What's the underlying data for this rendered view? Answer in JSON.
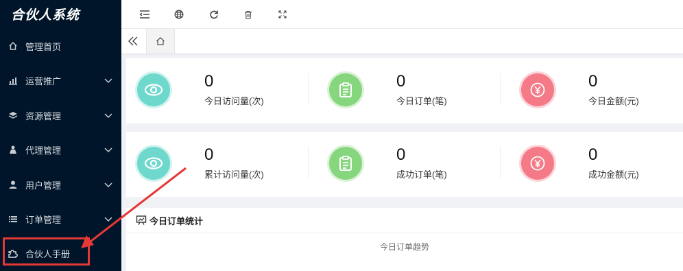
{
  "sidebar": {
    "logo": "合伙人系统",
    "items": [
      {
        "label": "管理首页",
        "icon": "home-icon"
      },
      {
        "label": "运营推广",
        "icon": "chart-icon"
      },
      {
        "label": "资源管理",
        "icon": "layers-icon"
      },
      {
        "label": "代理管理",
        "icon": "agent-icon"
      },
      {
        "label": "用户管理",
        "icon": "user-icon"
      },
      {
        "label": "订单管理",
        "icon": "list-icon"
      },
      {
        "label": "合伙人手册",
        "icon": "puzzle-icon"
      }
    ]
  },
  "toolbar": {
    "icons": [
      "menu-fold-icon",
      "globe-icon",
      "refresh-icon",
      "trash-icon",
      "fullscreen-icon"
    ]
  },
  "tabs": {
    "home_icon": "home-icon"
  },
  "stats_today": [
    {
      "value": "0",
      "label": "今日访问量(次)",
      "color": "#6ed8cd",
      "icon": "eye-icon"
    },
    {
      "value": "0",
      "label": "今日订单(笔)",
      "color": "#86d67e",
      "icon": "clipboard-icon"
    },
    {
      "value": "0",
      "label": "今日金额(元)",
      "color": "#f47a88",
      "icon": "yen-icon"
    }
  ],
  "stats_total": [
    {
      "value": "0",
      "label": "累计访问量(次)",
      "color": "#6ed8cd",
      "icon": "eye-icon"
    },
    {
      "value": "0",
      "label": "成功订单(笔)",
      "color": "#86d67e",
      "icon": "clipboard-icon"
    },
    {
      "value": "0",
      "label": "成功金额(元)",
      "color": "#f47a88",
      "icon": "yen-icon"
    }
  ],
  "order_panel": {
    "title": "今日订单统计",
    "subtitle": "今日订单趋势"
  },
  "annotation_color": "#e53935"
}
